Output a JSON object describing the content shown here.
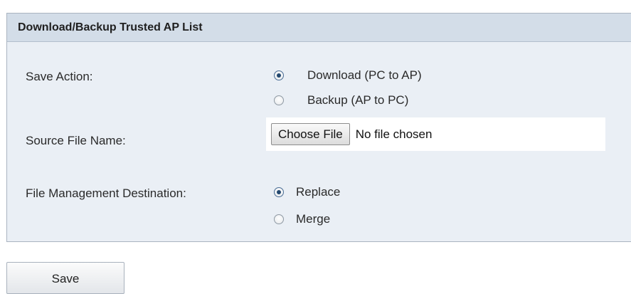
{
  "panel": {
    "title": "Download/Backup Trusted AP List"
  },
  "save_action": {
    "label": "Save Action:",
    "options": [
      {
        "label": "Download (PC to AP)",
        "checked": true
      },
      {
        "label": "Backup (AP to PC)",
        "checked": false
      }
    ]
  },
  "source_file": {
    "label": "Source File Name:",
    "button_label": "Choose File",
    "status": "No file chosen"
  },
  "destination": {
    "label": "File Management Destination:",
    "options": [
      {
        "label": "Replace",
        "checked": true
      },
      {
        "label": "Merge",
        "checked": false
      }
    ]
  },
  "footer": {
    "save_label": "Save"
  },
  "colors": {
    "panel_bg": "#eaeff5",
    "header_bg": "#d3dde8",
    "radio_dot": "#23486f"
  }
}
